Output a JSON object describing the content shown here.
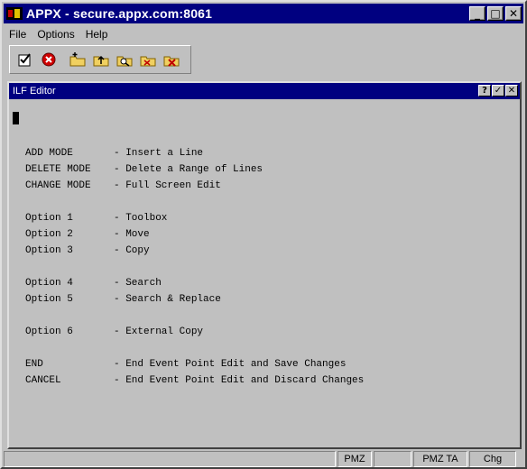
{
  "window": {
    "title": "APPX - secure.appx.com:8061"
  },
  "menu": [
    "File",
    "Options",
    "Help"
  ],
  "toolbar": {
    "icons": [
      "checklist-icon",
      "cancel-icon",
      "folder-new-icon",
      "folder-up-icon",
      "folder-search-icon",
      "folder-close-icon",
      "folder-cancel-icon"
    ]
  },
  "editor": {
    "title": "ILF Editor",
    "lines": [
      {
        "key": "ADD MODE",
        "desc": "- Insert a Line"
      },
      {
        "key": "DELETE MODE",
        "desc": "- Delete a Range of Lines"
      },
      {
        "key": "CHANGE MODE",
        "desc": "- Full Screen Edit"
      },
      {
        "key": "Option 1",
        "desc": "- Toolbox"
      },
      {
        "key": "Option 2",
        "desc": "- Move"
      },
      {
        "key": "Option 3",
        "desc": "- Copy"
      },
      {
        "key": "Option 4",
        "desc": "- Search"
      },
      {
        "key": "Option 5",
        "desc": "- Search & Replace"
      },
      {
        "key": "Option 6",
        "desc": "- External Copy"
      },
      {
        "key": "END",
        "desc": "- End Event Point Edit and Save Changes"
      },
      {
        "key": "CANCEL",
        "desc": "- End Event Point Edit and Discard Changes"
      }
    ]
  },
  "status": {
    "cells": [
      "",
      "PMZ",
      "",
      "PMZ TA",
      "Chg"
    ]
  },
  "colors": {
    "titlebar": "#000080",
    "face": "#c0c0c0"
  }
}
